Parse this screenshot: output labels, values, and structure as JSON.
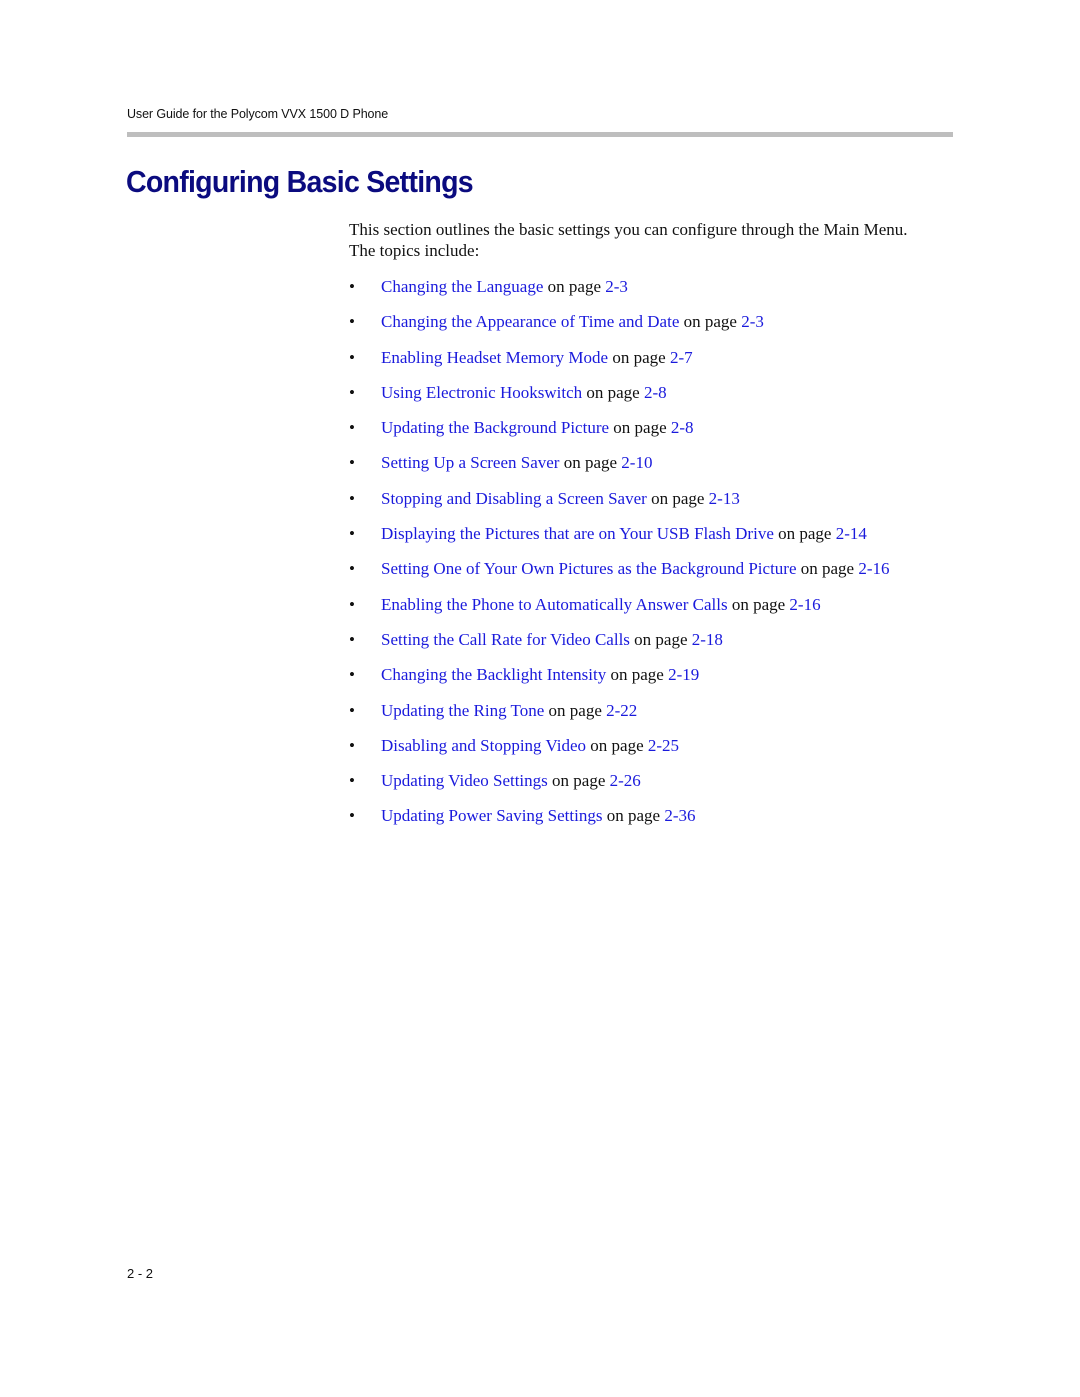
{
  "header": {
    "running_title": "User Guide for the Polycom VVX 1500 D Phone"
  },
  "section": {
    "title": "Configuring Basic Settings",
    "intro": "This section outlines the basic settings you can configure through the Main Menu. The topics include:"
  },
  "colors": {
    "title": "#0b0b7f",
    "link": "#1a1adc",
    "rule": "#bebebe"
  },
  "topics": [
    {
      "label": "Changing the Language",
      "connector": " on page ",
      "page": "2-3"
    },
    {
      "label": "Changing the Appearance of Time and Date",
      "connector": " on page ",
      "page": "2-3"
    },
    {
      "label": "Enabling Headset Memory Mode",
      "connector": " on page ",
      "page": "2-7"
    },
    {
      "label": "Using Electronic Hookswitch",
      "connector": " on page ",
      "page": "2-8"
    },
    {
      "label": "Updating the Background Picture",
      "connector": " on page ",
      "page": "2-8"
    },
    {
      "label": "Setting Up a Screen Saver",
      "connector": " on page ",
      "page": "2-10"
    },
    {
      "label": "Stopping and Disabling a Screen Saver",
      "connector": " on page ",
      "page": "2-13"
    },
    {
      "label": "Displaying the Pictures that are on Your USB Flash Drive",
      "connector": " on page ",
      "page": "2-14"
    },
    {
      "label": "Setting One of Your Own Pictures as the Background Picture",
      "connector": " on page ",
      "page": "2-16"
    },
    {
      "label": "Enabling the Phone to Automatically Answer Calls",
      "connector": " on page ",
      "page": "2-16"
    },
    {
      "label": "Setting the Call Rate for Video Calls",
      "connector": " on page ",
      "page": "2-18"
    },
    {
      "label": "Changing the Backlight Intensity",
      "connector": " on page ",
      "page": "2-19"
    },
    {
      "label": "Updating the Ring Tone",
      "connector": " on page ",
      "page": "2-22"
    },
    {
      "label": "Disabling and Stopping Video",
      "connector": " on page ",
      "page": "2-25"
    },
    {
      "label": "Updating Video Settings",
      "connector": " on page ",
      "page": "2-26"
    },
    {
      "label": "Updating Power Saving Settings",
      "connector": " on page ",
      "page": "2-36"
    }
  ],
  "bullet_glyph": "•",
  "footer": {
    "page_number": "2 - 2"
  }
}
